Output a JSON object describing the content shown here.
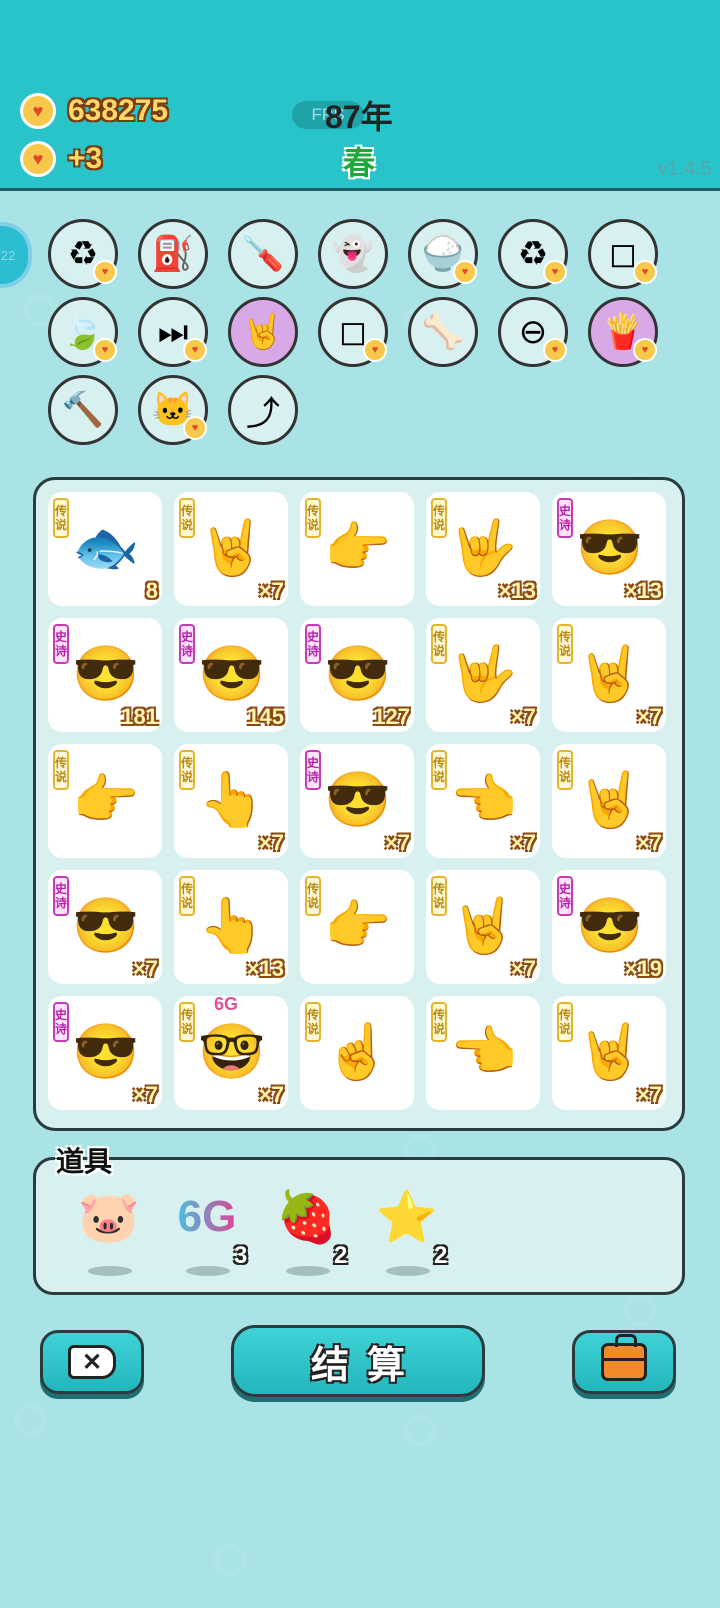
{
  "header": {
    "gold": "638275",
    "income": "+3",
    "fps_label": "FPS",
    "year": "87年",
    "season": "春",
    "version": "v1.4.5",
    "side_badge": "22"
  },
  "tools": [
    {
      "name": "refresh-tool",
      "glyph": "♻",
      "bg": "#d8f0ef",
      "heart": true
    },
    {
      "name": "pump-tool",
      "glyph": "⛽",
      "bg": "#d8f0ef",
      "heart": false
    },
    {
      "name": "screwdriver-tool",
      "glyph": "🪛",
      "bg": "#d8f0ef",
      "heart": false
    },
    {
      "name": "ghost-tool",
      "glyph": "👻",
      "bg": "#d8f0ef",
      "heart": false
    },
    {
      "name": "rice-bowl-tool",
      "glyph": "🍚",
      "bg": "#d8f0ef",
      "heart": true
    },
    {
      "name": "refresh-tool-2",
      "glyph": "♻",
      "bg": "#d8f0ef",
      "heart": true
    },
    {
      "name": "sugar-cubes-tool",
      "glyph": "◻",
      "bg": "#d8f0ef",
      "heart": true
    },
    {
      "name": "leaf-tool",
      "glyph": "🍃",
      "bg": "#d8f0ef",
      "heart": true
    },
    {
      "name": "skip-tool",
      "glyph": "⏭",
      "bg": "#d8f0ef",
      "heart": true
    },
    {
      "name": "rock-hand-tool",
      "glyph": "🤘",
      "bg": "#d9a8e6",
      "heart": false
    },
    {
      "name": "sugar-cubes-tool-2",
      "glyph": "◻",
      "bg": "#d8f0ef",
      "heart": true
    },
    {
      "name": "pet-food-tool",
      "glyph": "🦴",
      "bg": "#d8f0ef",
      "heart": false
    },
    {
      "name": "remove-tool",
      "glyph": "⊖",
      "bg": "#d8f0ef",
      "heart": true
    },
    {
      "name": "fries-tool",
      "glyph": "🍟",
      "bg": "#d9a8e6",
      "heart": true
    },
    {
      "name": "hammer-tool",
      "glyph": "🔨",
      "bg": "#d8f0ef",
      "heart": false
    },
    {
      "name": "cat-tool",
      "glyph": "🐱",
      "bg": "#d8f0ef",
      "heart": true
    },
    {
      "name": "upgrade-arrow-tool",
      "glyph": "⤴",
      "bg": "#d8f0ef",
      "heart": false
    }
  ],
  "rarity_labels": {
    "legend": [
      "传",
      "说"
    ],
    "epic": [
      "史",
      "诗"
    ]
  },
  "cards": [
    {
      "rarity": "legend",
      "icon": "fish",
      "glyph": "🐟",
      "count": "8"
    },
    {
      "rarity": "legend",
      "icon": "hand",
      "glyph": "🤘",
      "count": "×7"
    },
    {
      "rarity": "legend",
      "icon": "hand",
      "glyph": "👉",
      "count": ""
    },
    {
      "rarity": "legend",
      "icon": "hand",
      "glyph": "🤟",
      "count": "×13"
    },
    {
      "rarity": "epic",
      "icon": "face",
      "glyph": "😎",
      "count": "×13"
    },
    {
      "rarity": "epic",
      "icon": "face",
      "glyph": "😎",
      "count": "181"
    },
    {
      "rarity": "epic",
      "icon": "face",
      "glyph": "😎",
      "count": "145"
    },
    {
      "rarity": "epic",
      "icon": "face",
      "glyph": "😎",
      "count": "127"
    },
    {
      "rarity": "legend",
      "icon": "hand",
      "glyph": "🤟",
      "count": "×7"
    },
    {
      "rarity": "legend",
      "icon": "hand",
      "glyph": "🤘",
      "count": "×7"
    },
    {
      "rarity": "legend",
      "icon": "hand",
      "glyph": "👉",
      "count": ""
    },
    {
      "rarity": "legend",
      "icon": "hand",
      "glyph": "👆",
      "count": "×7"
    },
    {
      "rarity": "epic",
      "icon": "face",
      "glyph": "😎",
      "count": "×7"
    },
    {
      "rarity": "legend",
      "icon": "hand",
      "glyph": "👈",
      "count": "×7"
    },
    {
      "rarity": "legend",
      "icon": "hand",
      "glyph": "🤘",
      "count": "×7"
    },
    {
      "rarity": "epic",
      "icon": "face",
      "glyph": "😎",
      "count": "×7"
    },
    {
      "rarity": "legend",
      "icon": "hand",
      "glyph": "👆",
      "count": "×13"
    },
    {
      "rarity": "legend",
      "icon": "hand",
      "glyph": "👉",
      "count": ""
    },
    {
      "rarity": "legend",
      "icon": "hand",
      "glyph": "🤘",
      "count": "×7"
    },
    {
      "rarity": "epic",
      "icon": "face",
      "glyph": "😎",
      "count": "×19"
    },
    {
      "rarity": "epic",
      "icon": "face",
      "glyph": "😎",
      "count": "×7"
    },
    {
      "rarity": "legend",
      "icon": "bald-face",
      "glyph": "🤓",
      "count": "×7",
      "top_label": "6G"
    },
    {
      "rarity": "legend",
      "icon": "hand",
      "glyph": "☝",
      "count": ""
    },
    {
      "rarity": "legend",
      "icon": "hand",
      "glyph": "👈",
      "count": ""
    },
    {
      "rarity": "legend",
      "icon": "hand",
      "glyph": "🤘",
      "count": "×7"
    }
  ],
  "props": {
    "title": "道具",
    "items": [
      {
        "name": "piggy-bank",
        "glyph": "🐷",
        "count": ""
      },
      {
        "name": "6g",
        "glyph": "6G",
        "count": "3"
      },
      {
        "name": "bayberry",
        "glyph": "🍓",
        "count": "2"
      },
      {
        "name": "star",
        "glyph": "⭐",
        "count": "2"
      }
    ]
  },
  "buttons": {
    "settle": "结算",
    "close_glyph": "✕"
  }
}
